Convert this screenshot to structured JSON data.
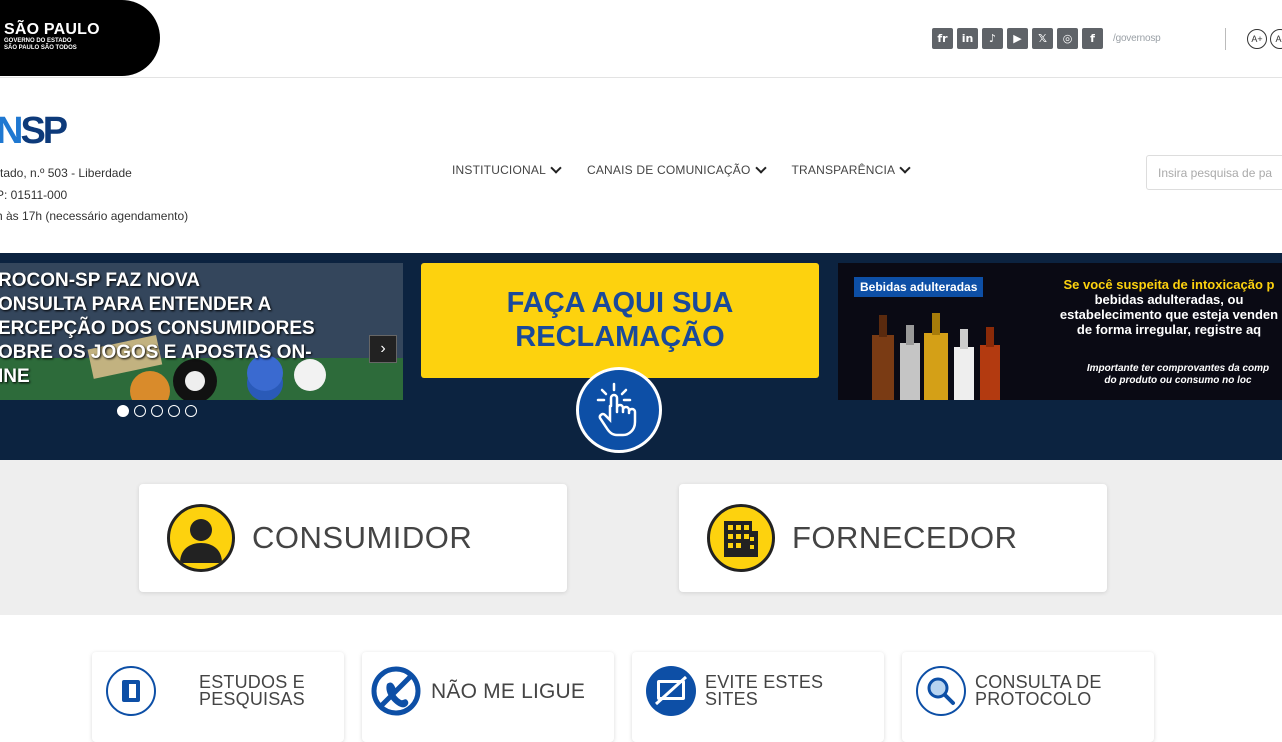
{
  "gov_bar": {
    "logo_line1": "SÃO PAULO",
    "logo_line2": "GOVERNO DO ESTADO",
    "logo_line3": "SÃO PAULO SÃO TODOS",
    "social": [
      "fr",
      "in",
      "♪",
      "▶",
      "𝕏",
      "◎",
      "f"
    ],
    "social_handle": "/governosp",
    "accessibility": [
      "A+",
      "A-"
    ]
  },
  "header": {
    "logo_text": "SP",
    "logo_prefix": "N",
    "address_lines": [
      "rtado, n.º 503 - Liberdade",
      "P: 01511-000",
      "h às 17h (necessário agendamento)"
    ],
    "nav": [
      "INSTITUCIONAL",
      "CANAIS DE COMUNICAÇÃO",
      "TRANSPARÊNCIA"
    ],
    "search_placeholder": "Insira pesquisa de pa"
  },
  "banner": {
    "slide1_text": "ROCON-SP FAZ NOVA CONSULTA PARA ENTENDER A PERCEPÇÃO DOS CONSUMIDORES SOBRE OS JOGOS E APOSTAS ON-LINE",
    "slide1_lines": [
      "ROCON-SP FAZ NOVA",
      "ONSULTA PARA ENTENDER A",
      "ERCEPÇÃO DOS CONSUMIDORES",
      "OBRE OS JOGOS E APOSTAS ON-",
      "INE"
    ],
    "next_label": "›",
    "dot_count": 5,
    "active_dot": 0,
    "complaint_line1": "FAÇA AQUI SUA",
    "complaint_line2": "RECLAMAÇÃO",
    "slide3_tag": "Bebidas adulteradas",
    "slide3_msg_line1": "Se você suspeita de intoxicação p",
    "slide3_msg_line2": "bebidas adulteradas, ou",
    "slide3_msg_line3": "estabelecimento que esteja venden",
    "slide3_msg_line4": "de forma irregular, registre aq",
    "slide3_sub_line1": "Importante ter comprovantes da comp",
    "slide3_sub_line2": "do produto ou consumo no loc"
  },
  "cards": {
    "consumer": "CONSUMIDOR",
    "supplier": "FORNECEDOR"
  },
  "services": [
    {
      "line1": "ESTUDOS E",
      "line2": "PESQUISAS"
    },
    {
      "line1": "NÃO ME LIGUE",
      "line2": ""
    },
    {
      "line1": "EVITE ESTES",
      "line2": "SITES"
    },
    {
      "line1": "CONSULTA DE",
      "line2": "PROTOCOLO"
    }
  ],
  "colors": {
    "brand_yellow": "#fdd20e",
    "brand_blue": "#0d4fa6",
    "banner_bg": "#0c2340"
  }
}
